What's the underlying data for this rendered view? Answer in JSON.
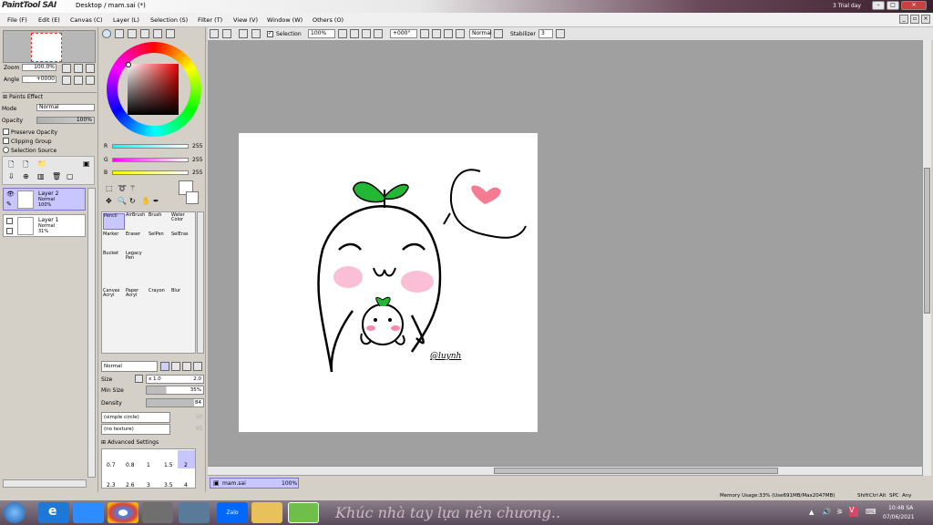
{
  "window": {
    "app_logo": "PaintTool SAI",
    "title": "Desktop / mam.sai (*)",
    "trial_text": "3 Trial day"
  },
  "menu": [
    "File (F)",
    "Edit (E)",
    "Canvas (C)",
    "Layer (L)",
    "Selection (S)",
    "Filter (T)",
    "View (V)",
    "Window (W)",
    "Others (O)"
  ],
  "nav": {
    "zoom_label": "Zoom",
    "zoom_value": "100.0%",
    "angle_label": "Angle",
    "angle_value": "+0000"
  },
  "layer_props": {
    "paints_effect": "Paints Effect",
    "mode_label": "Mode",
    "mode_value": "Normal",
    "opacity_label": "Opacity",
    "opacity_value": "100%",
    "preserve_opacity": "Preserve Opacity",
    "clipping_group": "Clipping Group",
    "selection_source": "Selection Source"
  },
  "layers": [
    {
      "name": "Layer 2",
      "mode": "Normal",
      "opacity": "100%"
    },
    {
      "name": "Layer 1",
      "mode": "Normal",
      "opacity": "31%"
    }
  ],
  "rgb": {
    "r_label": "R",
    "r_value": "255",
    "g_label": "G",
    "g_value": "255",
    "b_label": "B",
    "b_value": "255"
  },
  "tools": [
    [
      "Pencil",
      "AirBrush",
      "Brush",
      "Water Color"
    ],
    [
      "Marker",
      "Eraser",
      "SelPen",
      "SelEras"
    ],
    [
      "Bucket",
      "Legacy Pen",
      "",
      ""
    ],
    [
      "Canvas Acryl",
      "Paper Acryl",
      "Crayon",
      "Blur"
    ]
  ],
  "brush": {
    "blend": "Normal",
    "size_label": "Size",
    "size_mult": "x 1.0",
    "size_value": "2.0",
    "minsize_label": "Min Size",
    "minsize_value": "35%",
    "density_label": "Density",
    "density_value": "84",
    "shape": "(simple circle)",
    "shape_val": "50",
    "texture": "(no texture)",
    "texture_val": "95",
    "advanced": "Advanced Settings",
    "sizes_row1": [
      "0.7",
      "0.8",
      "1",
      "1.5",
      "2"
    ],
    "sizes_row2": [
      "2.3",
      "2.6",
      "3",
      "3.5",
      "4"
    ]
  },
  "toolbar": {
    "selection_label": "Selection",
    "zoom_value": "100%",
    "angle_value": "+000°",
    "mode_value": "Normal",
    "stabilizer_label": "Stabilizer",
    "stabilizer_value": "3"
  },
  "status": {
    "tab_name": "mam.sai",
    "tab_zoom": "100%",
    "memory": "Memory Usage:33% (Use691MB/Max2047MB)",
    "keys": [
      "Shift",
      "Ctrl",
      "Alt",
      "SPC",
      "Any"
    ]
  },
  "canvas_text": {
    "signature": "@luynh"
  },
  "taskbar": {
    "banner": "Khúc nhà tay lựa nên chương..",
    "time": "10:48 SA",
    "date": "07/06/2021",
    "zalo": "Zalo"
  },
  "colors": {
    "layer_selected": "#c9c5ff",
    "workspace": "#a0a0a0",
    "sprout": "#22b833",
    "blush": "#f58bb0"
  }
}
